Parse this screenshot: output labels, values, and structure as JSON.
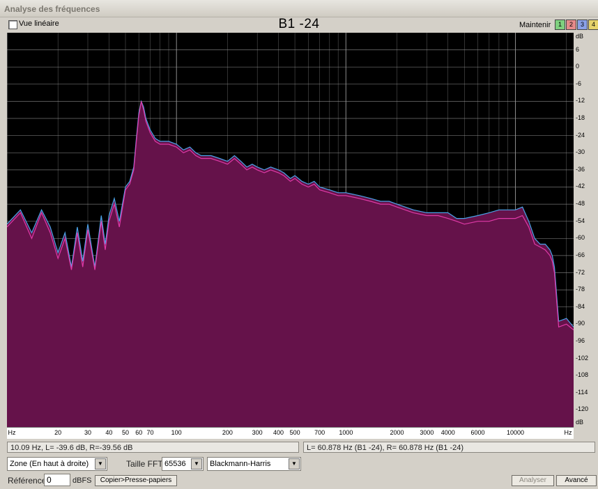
{
  "window": {
    "title": "Analyse des fréquences"
  },
  "header": {
    "linear_view_label": "Vue linéaire",
    "chart_title": "B1 -24",
    "hold_label": "Maintenir",
    "hold_buttons": [
      "1",
      "2",
      "3",
      "4"
    ]
  },
  "colors": {
    "plot_background": "#000000",
    "fill": "#65124a",
    "left_channel": "#4aa3e8",
    "right_channel": "#e03aa8",
    "grid": "#9a9a9a",
    "hold_1": "#7fd07f",
    "hold_2": "#e58a8a",
    "hold_3": "#8aa0e6",
    "hold_4": "#e6d36b"
  },
  "chart_data": {
    "type": "area",
    "xscale": "log",
    "xunit": "Hz",
    "yunit": "dB",
    "xlim": [
      10,
      22050
    ],
    "ylim": [
      -126,
      12
    ],
    "x_ticks": [
      "20",
      "30",
      "40",
      "50",
      "60",
      "70",
      "100",
      "200",
      "300",
      "400",
      "500",
      "700",
      "1000",
      "2000",
      "3000",
      "4000",
      "6000",
      "10000"
    ],
    "y_ticks": [
      "6",
      "0",
      "-6",
      "-12",
      "-18",
      "-24",
      "-30",
      "-36",
      "-42",
      "-48",
      "-54",
      "-60",
      "-66",
      "-72",
      "-78",
      "-84",
      "-90",
      "-96",
      "-102",
      "-108",
      "-114",
      "-120"
    ],
    "series": [
      {
        "channel": "L",
        "x": [
          10,
          12,
          14,
          16,
          18,
          20,
          22,
          24,
          26,
          28,
          30,
          33,
          36,
          38,
          40,
          43,
          46,
          50,
          53,
          56,
          58,
          60,
          62,
          64,
          66,
          70,
          75,
          80,
          90,
          100,
          110,
          120,
          130,
          140,
          160,
          180,
          200,
          220,
          240,
          260,
          280,
          300,
          330,
          360,
          400,
          430,
          470,
          500,
          550,
          600,
          650,
          700,
          800,
          900,
          1000,
          1200,
          1400,
          1600,
          1800,
          2000,
          2500,
          3000,
          3500,
          4000,
          4500,
          5000,
          6000,
          7000,
          8000,
          9000,
          10000,
          11000,
          12000,
          13000,
          14000,
          15000,
          16000,
          16500,
          17000,
          18000,
          20000,
          22050
        ],
        "y": [
          -55,
          -50,
          -58,
          -50,
          -56,
          -65,
          -58,
          -70,
          -56,
          -68,
          -55,
          -70,
          -52,
          -62,
          -52,
          -46,
          -54,
          -42,
          -40,
          -35,
          -25,
          -16,
          -12,
          -14,
          -18,
          -22,
          -25,
          -26,
          -26,
          -27,
          -29,
          -28,
          -30,
          -31,
          -31,
          -32,
          -33,
          -31,
          -33,
          -35,
          -34,
          -35,
          -36,
          -35,
          -36,
          -37,
          -39,
          -38,
          -40,
          -41,
          -40,
          -42,
          -43,
          -44,
          -44,
          -45,
          -46,
          -47,
          -47,
          -48,
          -50,
          -51,
          -51,
          -51,
          -53,
          -53,
          -52,
          -51,
          -50,
          -50,
          -50,
          -49,
          -54,
          -60,
          -62,
          -62,
          -64,
          -66,
          -70,
          -89,
          -88,
          -91
        ]
      },
      {
        "channel": "R",
        "x": [
          10,
          12,
          14,
          16,
          18,
          20,
          22,
          24,
          26,
          28,
          30,
          33,
          36,
          38,
          40,
          43,
          46,
          50,
          53,
          56,
          58,
          60,
          62,
          64,
          66,
          70,
          75,
          80,
          90,
          100,
          110,
          120,
          130,
          140,
          160,
          180,
          200,
          220,
          240,
          260,
          280,
          300,
          330,
          360,
          400,
          430,
          470,
          500,
          550,
          600,
          650,
          700,
          800,
          900,
          1000,
          1200,
          1400,
          1600,
          1800,
          2000,
          2500,
          3000,
          3500,
          4000,
          4500,
          5000,
          6000,
          7000,
          8000,
          9000,
          10000,
          11000,
          12000,
          13000,
          14000,
          15000,
          16000,
          16500,
          17000,
          18000,
          20000,
          22050
        ],
        "y": [
          -56,
          -51,
          -60,
          -51,
          -58,
          -67,
          -60,
          -71,
          -58,
          -70,
          -57,
          -71,
          -54,
          -64,
          -54,
          -48,
          -56,
          -43,
          -41,
          -36,
          -26,
          -17,
          -12,
          -15,
          -19,
          -23,
          -26,
          -27,
          -27,
          -28,
          -30,
          -29,
          -31,
          -32,
          -32,
          -33,
          -34,
          -32,
          -34,
          -36,
          -35,
          -36,
          -37,
          -36,
          -37,
          -38,
          -40,
          -39,
          -41,
          -42,
          -41,
          -43,
          -44,
          -45,
          -45,
          -46,
          -47,
          -48,
          -48,
          -49,
          -51,
          -52,
          -52,
          -53,
          -54,
          -55,
          -54,
          -54,
          -53,
          -53,
          -53,
          -52,
          -56,
          -62,
          -63,
          -64,
          -66,
          -68,
          -72,
          -91,
          -90,
          -92
        ]
      }
    ]
  },
  "status": {
    "left": "10.09 Hz, L= -39.6 dB, R=-39.56 dB",
    "right": "L= 60.878 Hz (B1 -24), R= 60.878 Hz (B1 -24)"
  },
  "controls": {
    "zone_value": "Zone (En haut à droite)",
    "fft_label": "Taille FFT",
    "fft_value": "65536",
    "window_value": "Blackmann-Harris",
    "reference_label": "Référence",
    "reference_value": "0",
    "reference_unit": "dBFS",
    "copy_button": "Copier>Presse-papiers",
    "analyze_button": "Analyser",
    "advanced_button": "Avancé"
  }
}
